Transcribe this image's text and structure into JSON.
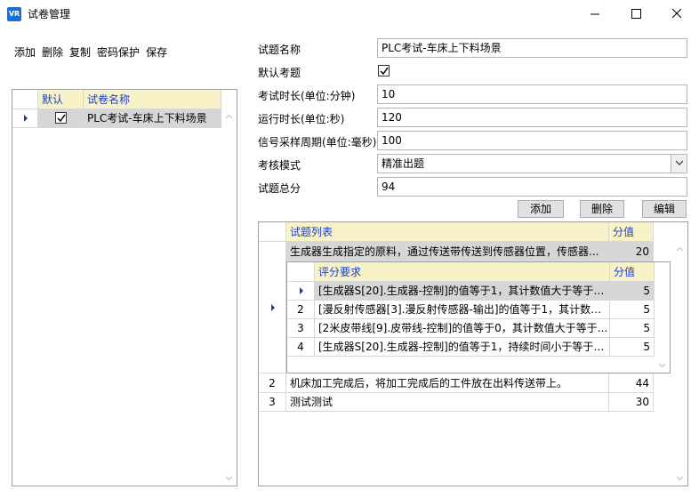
{
  "window": {
    "title": "试卷管理",
    "icon_text": "VR"
  },
  "toolbar": {
    "add": "添加",
    "delete": "删除",
    "copy": "复制",
    "password": "密码保护",
    "save": "保存"
  },
  "paper_list": {
    "col_default": "默认",
    "col_name": "试卷名称",
    "rows": [
      {
        "default": true,
        "name": "PLC考试-车床上下料场景"
      }
    ]
  },
  "form": {
    "name_label": "试题名称",
    "name_value": "PLC考试-车床上下料场景",
    "default_label": "默认考题",
    "default_checked": true,
    "exam_time_label": "考试时长(单位:分钟)",
    "exam_time_value": "10",
    "run_time_label": "运行时长(单位:秒)",
    "run_time_value": "120",
    "sample_label": "信号采样周期(单位:毫秒)",
    "sample_value": "100",
    "mode_label": "考核模式",
    "mode_value": "精准出题",
    "total_label": "试题总分",
    "total_value": "94"
  },
  "question_buttons": {
    "add": "添加",
    "delete": "删除",
    "edit": "编辑"
  },
  "questions": {
    "col_list": "试题列表",
    "col_score": "分值",
    "rows": [
      {
        "num": "",
        "text": "生成器生成指定的原料，通过传送带传送到传感器位置，传感器...",
        "score": "20"
      },
      {
        "num": "2",
        "text": "机床加工完成后，将加工完成后的工件放在出料传送带上。",
        "score": "44"
      },
      {
        "num": "3",
        "text": "测试测试",
        "score": "30"
      }
    ],
    "criteria": {
      "col_req": "评分要求",
      "col_score": "分值",
      "rows": [
        {
          "num": "",
          "text": "[生成器S[20].生成器-控制]的值等于1，其计数值大于等于1...",
          "score": "5"
        },
        {
          "num": "2",
          "text": "[漫反射传感器[3].漫反射传感器-输出]的值等于1，其计数值...",
          "score": "5"
        },
        {
          "num": "3",
          "text": "[2米皮带线[9].皮带线-控制]的值等于0，其计数值大于等于...",
          "score": "5"
        },
        {
          "num": "4",
          "text": "[生成器S[20].生成器-控制]的值等于1，持续时间小于等于1...",
          "score": "5"
        }
      ]
    }
  },
  "colors": {
    "header_bg": "#f7f2c8",
    "header_text": "#1f3fbf",
    "selected_row": "#d6d6d6",
    "border": "#a0a0a0"
  }
}
